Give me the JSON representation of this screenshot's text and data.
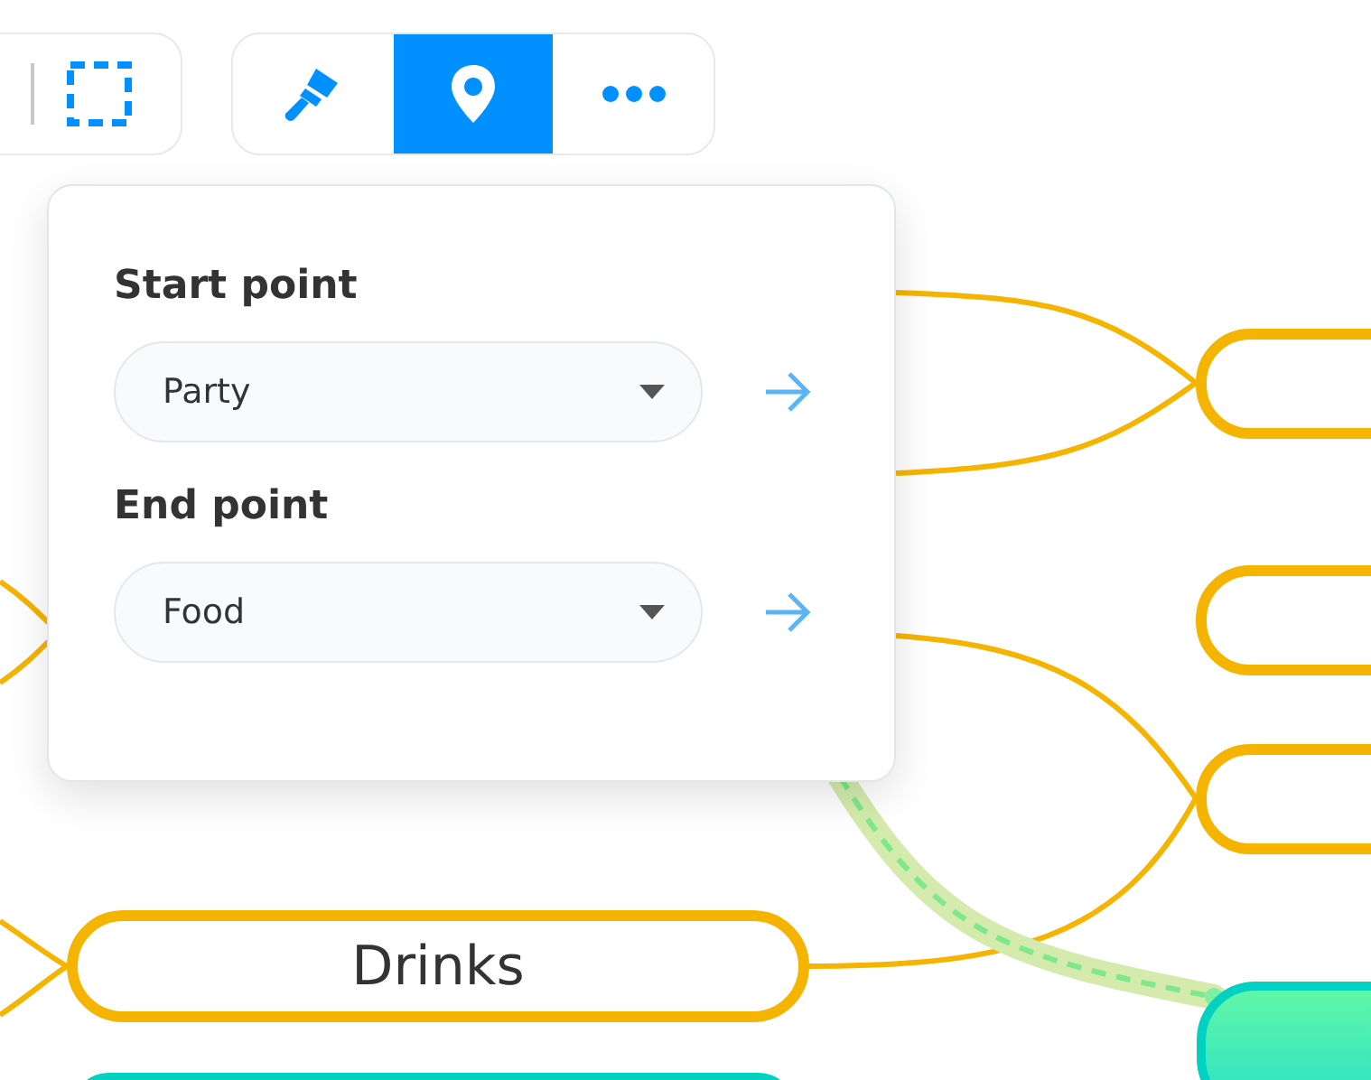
{
  "toolbar": {
    "left_tools": [
      {
        "kind": "divider"
      },
      {
        "kind": "select"
      }
    ],
    "right_tools": [
      {
        "kind": "paint",
        "selected": false
      },
      {
        "kind": "pin",
        "selected": true
      },
      {
        "kind": "more",
        "selected": false
      }
    ]
  },
  "route_panel": {
    "fields": [
      {
        "label": "Start point",
        "value": "Party"
      },
      {
        "label": "End point",
        "value": "Food"
      }
    ]
  },
  "mind_map": {
    "nodes": [
      {
        "label": "Drinks"
      }
    ]
  }
}
